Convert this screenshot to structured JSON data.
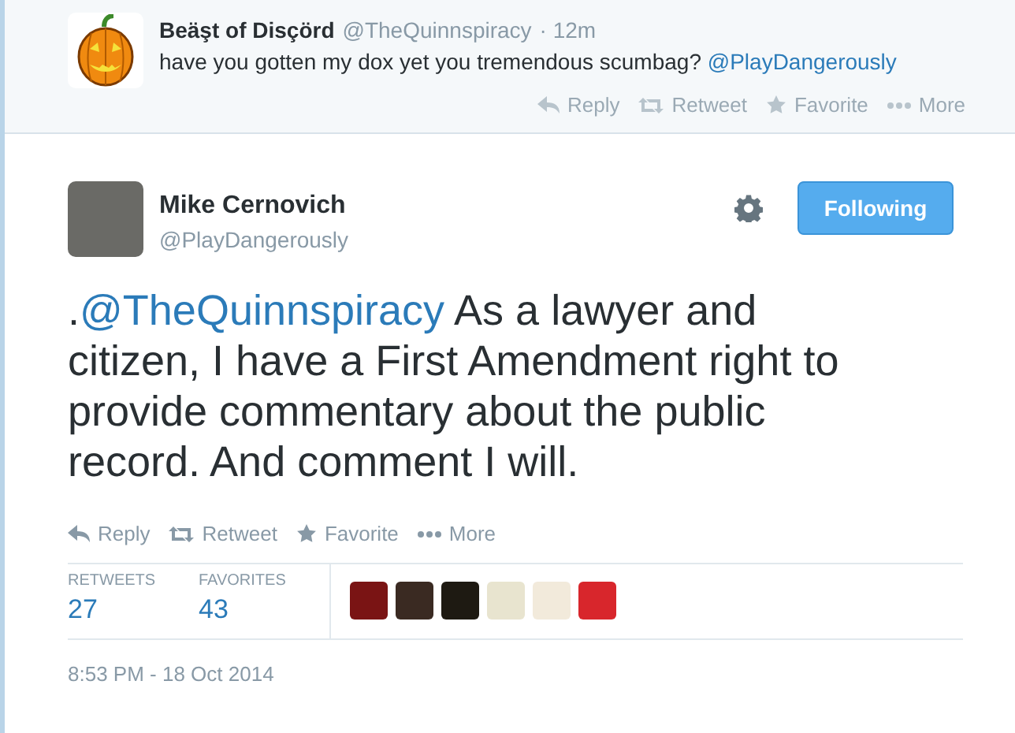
{
  "reply_tweet": {
    "name": "Beäşt of Disçörd",
    "handle": "@TheQuinnspiracy",
    "time": "· 12m",
    "text": "have you gotten my dox yet you tremendous scumbag?",
    "mention": "@PlayDangerously",
    "actions": [
      {
        "kind": "reply",
        "label": "Reply"
      },
      {
        "kind": "retweet",
        "label": "Retweet"
      },
      {
        "kind": "favorite",
        "label": "Favorite"
      },
      {
        "kind": "more",
        "label": "More"
      }
    ]
  },
  "tweet": {
    "name": "Mike Cernovich",
    "handle": "@PlayDangerously",
    "follow_button": "Following",
    "prefix": ".",
    "mention": "@TheQuinnspiracy",
    "text": "As a lawyer and citizen, I have a First Amendment right to provide commentary about the public record. And comment I will.",
    "actions": [
      {
        "kind": "reply",
        "label": "Reply"
      },
      {
        "kind": "retweet",
        "label": "Retweet"
      },
      {
        "kind": "favorite",
        "label": "Favorite"
      },
      {
        "kind": "more",
        "label": "More"
      }
    ],
    "stats": [
      {
        "label": "RETWEETS",
        "value": "27"
      },
      {
        "label": "FAVORITES",
        "value": "43"
      }
    ],
    "favoriter_avatars": [
      {
        "color": "#7a1414"
      },
      {
        "color": "#3a2a22"
      },
      {
        "color": "#1e1a12"
      },
      {
        "color": "#e8e4cf"
      },
      {
        "color": "#f2eadb"
      },
      {
        "color": "#d8262c"
      }
    ],
    "timestamp": "8:53 PM - 18 Oct 2014"
  }
}
